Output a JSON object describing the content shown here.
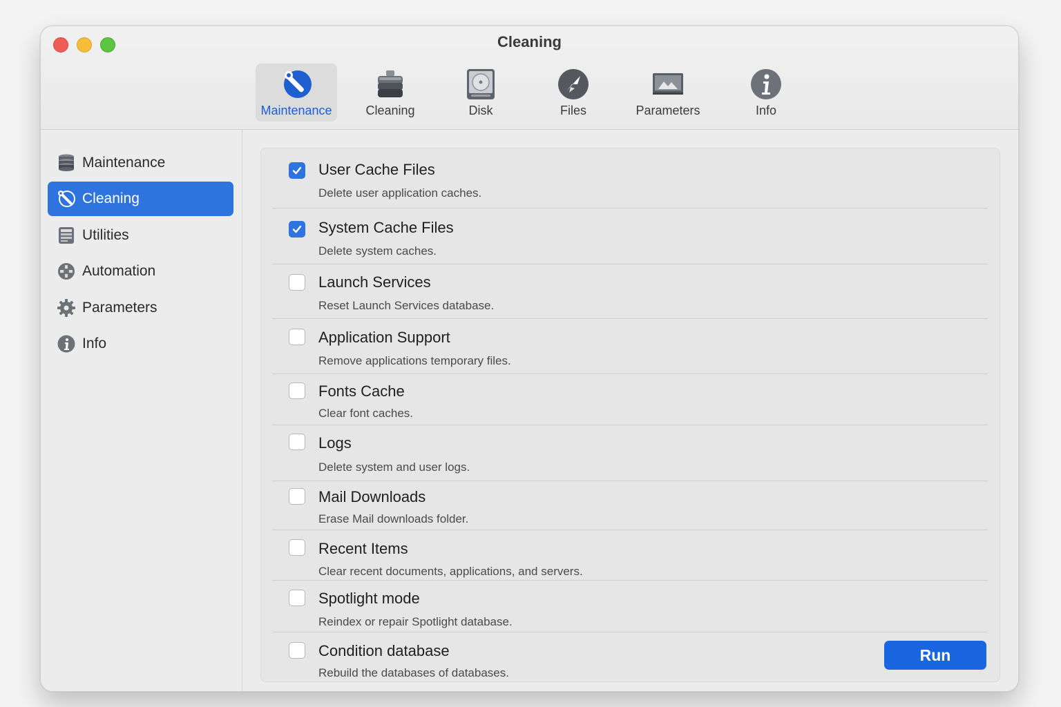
{
  "window": {
    "title": "Cleaning"
  },
  "toolbar": {
    "items": [
      {
        "label": "Maintenance",
        "icon": "wrench-icon",
        "active": true
      },
      {
        "label": "Cleaning",
        "icon": "drawer-icon",
        "active": false
      },
      {
        "label": "Disk",
        "icon": "disk-icon",
        "active": false
      },
      {
        "label": "Files",
        "icon": "files-icon",
        "active": false
      },
      {
        "label": "Parameters",
        "icon": "display-icon",
        "active": false
      },
      {
        "label": "Info",
        "icon": "info-icon",
        "active": false
      }
    ]
  },
  "sidebar": {
    "items": [
      {
        "label": "Maintenance",
        "icon": "database-icon",
        "active": false
      },
      {
        "label": "Cleaning",
        "icon": "wrench-icon",
        "active": true
      },
      {
        "label": "Utilities",
        "icon": "utilities-icon",
        "active": false
      },
      {
        "label": "Automation",
        "icon": "automation-icon",
        "active": false
      },
      {
        "label": "Parameters",
        "icon": "gear-icon",
        "active": false
      },
      {
        "label": "Info",
        "icon": "info-icon",
        "active": false
      }
    ]
  },
  "options": [
    {
      "title": "User Cache Files",
      "description": "Delete user application caches.",
      "checked": true
    },
    {
      "title": "System Cache Files",
      "description": "Delete system caches.",
      "checked": true
    },
    {
      "title": "Launch Services",
      "description": "Reset Launch Services database.",
      "checked": false
    },
    {
      "title": "Application Support",
      "description": "Remove applications temporary files.",
      "checked": false
    },
    {
      "title": "Fonts Cache",
      "description": "Clear font caches.",
      "checked": false
    },
    {
      "title": "Logs",
      "description": "Delete system and user logs.",
      "checked": false
    },
    {
      "title": "Mail Downloads",
      "description": "Erase Mail downloads folder.",
      "checked": false
    },
    {
      "title": "Recent Items",
      "description": "Clear recent documents, applications, and servers.",
      "checked": false
    },
    {
      "title": "Spotlight mode",
      "description": "Reindex or repair Spotlight database.",
      "checked": false
    },
    {
      "title": "Condition database",
      "description": "Rebuild the databases of databases.",
      "checked": false
    }
  ],
  "run_button": {
    "label": "Run"
  },
  "colors": {
    "accent": "#2f73df",
    "run": "#1a66e0"
  }
}
